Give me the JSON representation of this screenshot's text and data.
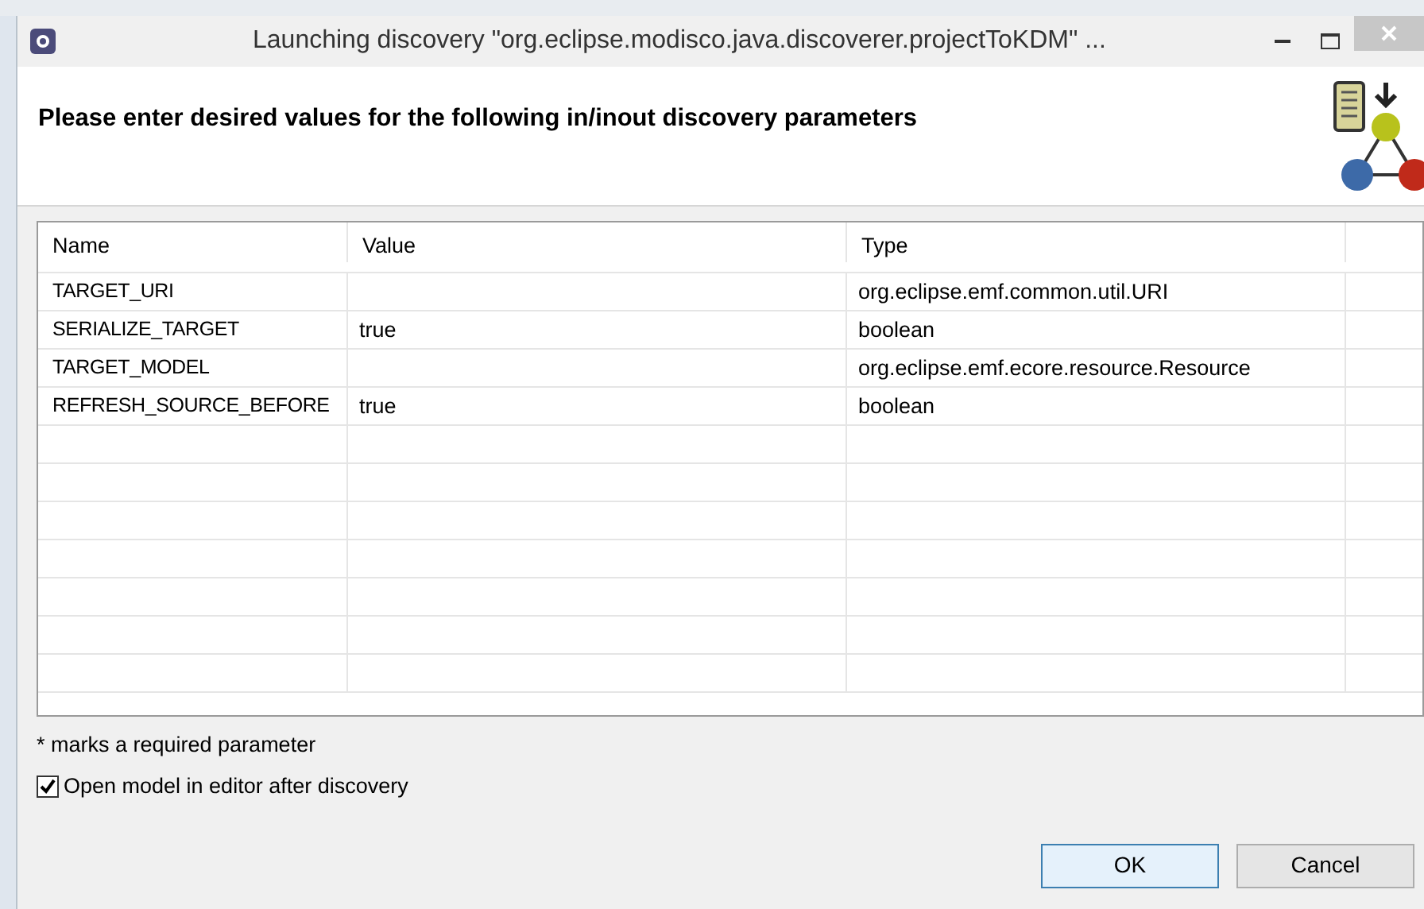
{
  "window": {
    "title": "Launching discovery \"org.eclipse.modisco.java.discoverer.projectToKDM\" ..."
  },
  "header": {
    "message": "Please enter desired values for the following in/inout discovery parameters"
  },
  "table": {
    "columns": [
      "Name",
      "Value",
      "Type"
    ],
    "rows": [
      {
        "name": "TARGET_URI",
        "value": "",
        "type": "org.eclipse.emf.common.util.URI"
      },
      {
        "name": "SERIALIZE_TARGET",
        "value": "true",
        "type": "boolean"
      },
      {
        "name": "TARGET_MODEL",
        "value": "",
        "type": "org.eclipse.emf.ecore.resource.Resource"
      },
      {
        "name": "REFRESH_SOURCE_BEFORE",
        "value": "true",
        "type": "boolean"
      }
    ]
  },
  "note": "* marks a required parameter",
  "open_in_editor": {
    "label": "Open model in editor after discovery",
    "checked": true
  },
  "buttons": [
    {
      "label": "OK",
      "default": true
    },
    {
      "label": "Cancel",
      "default": false
    }
  ]
}
